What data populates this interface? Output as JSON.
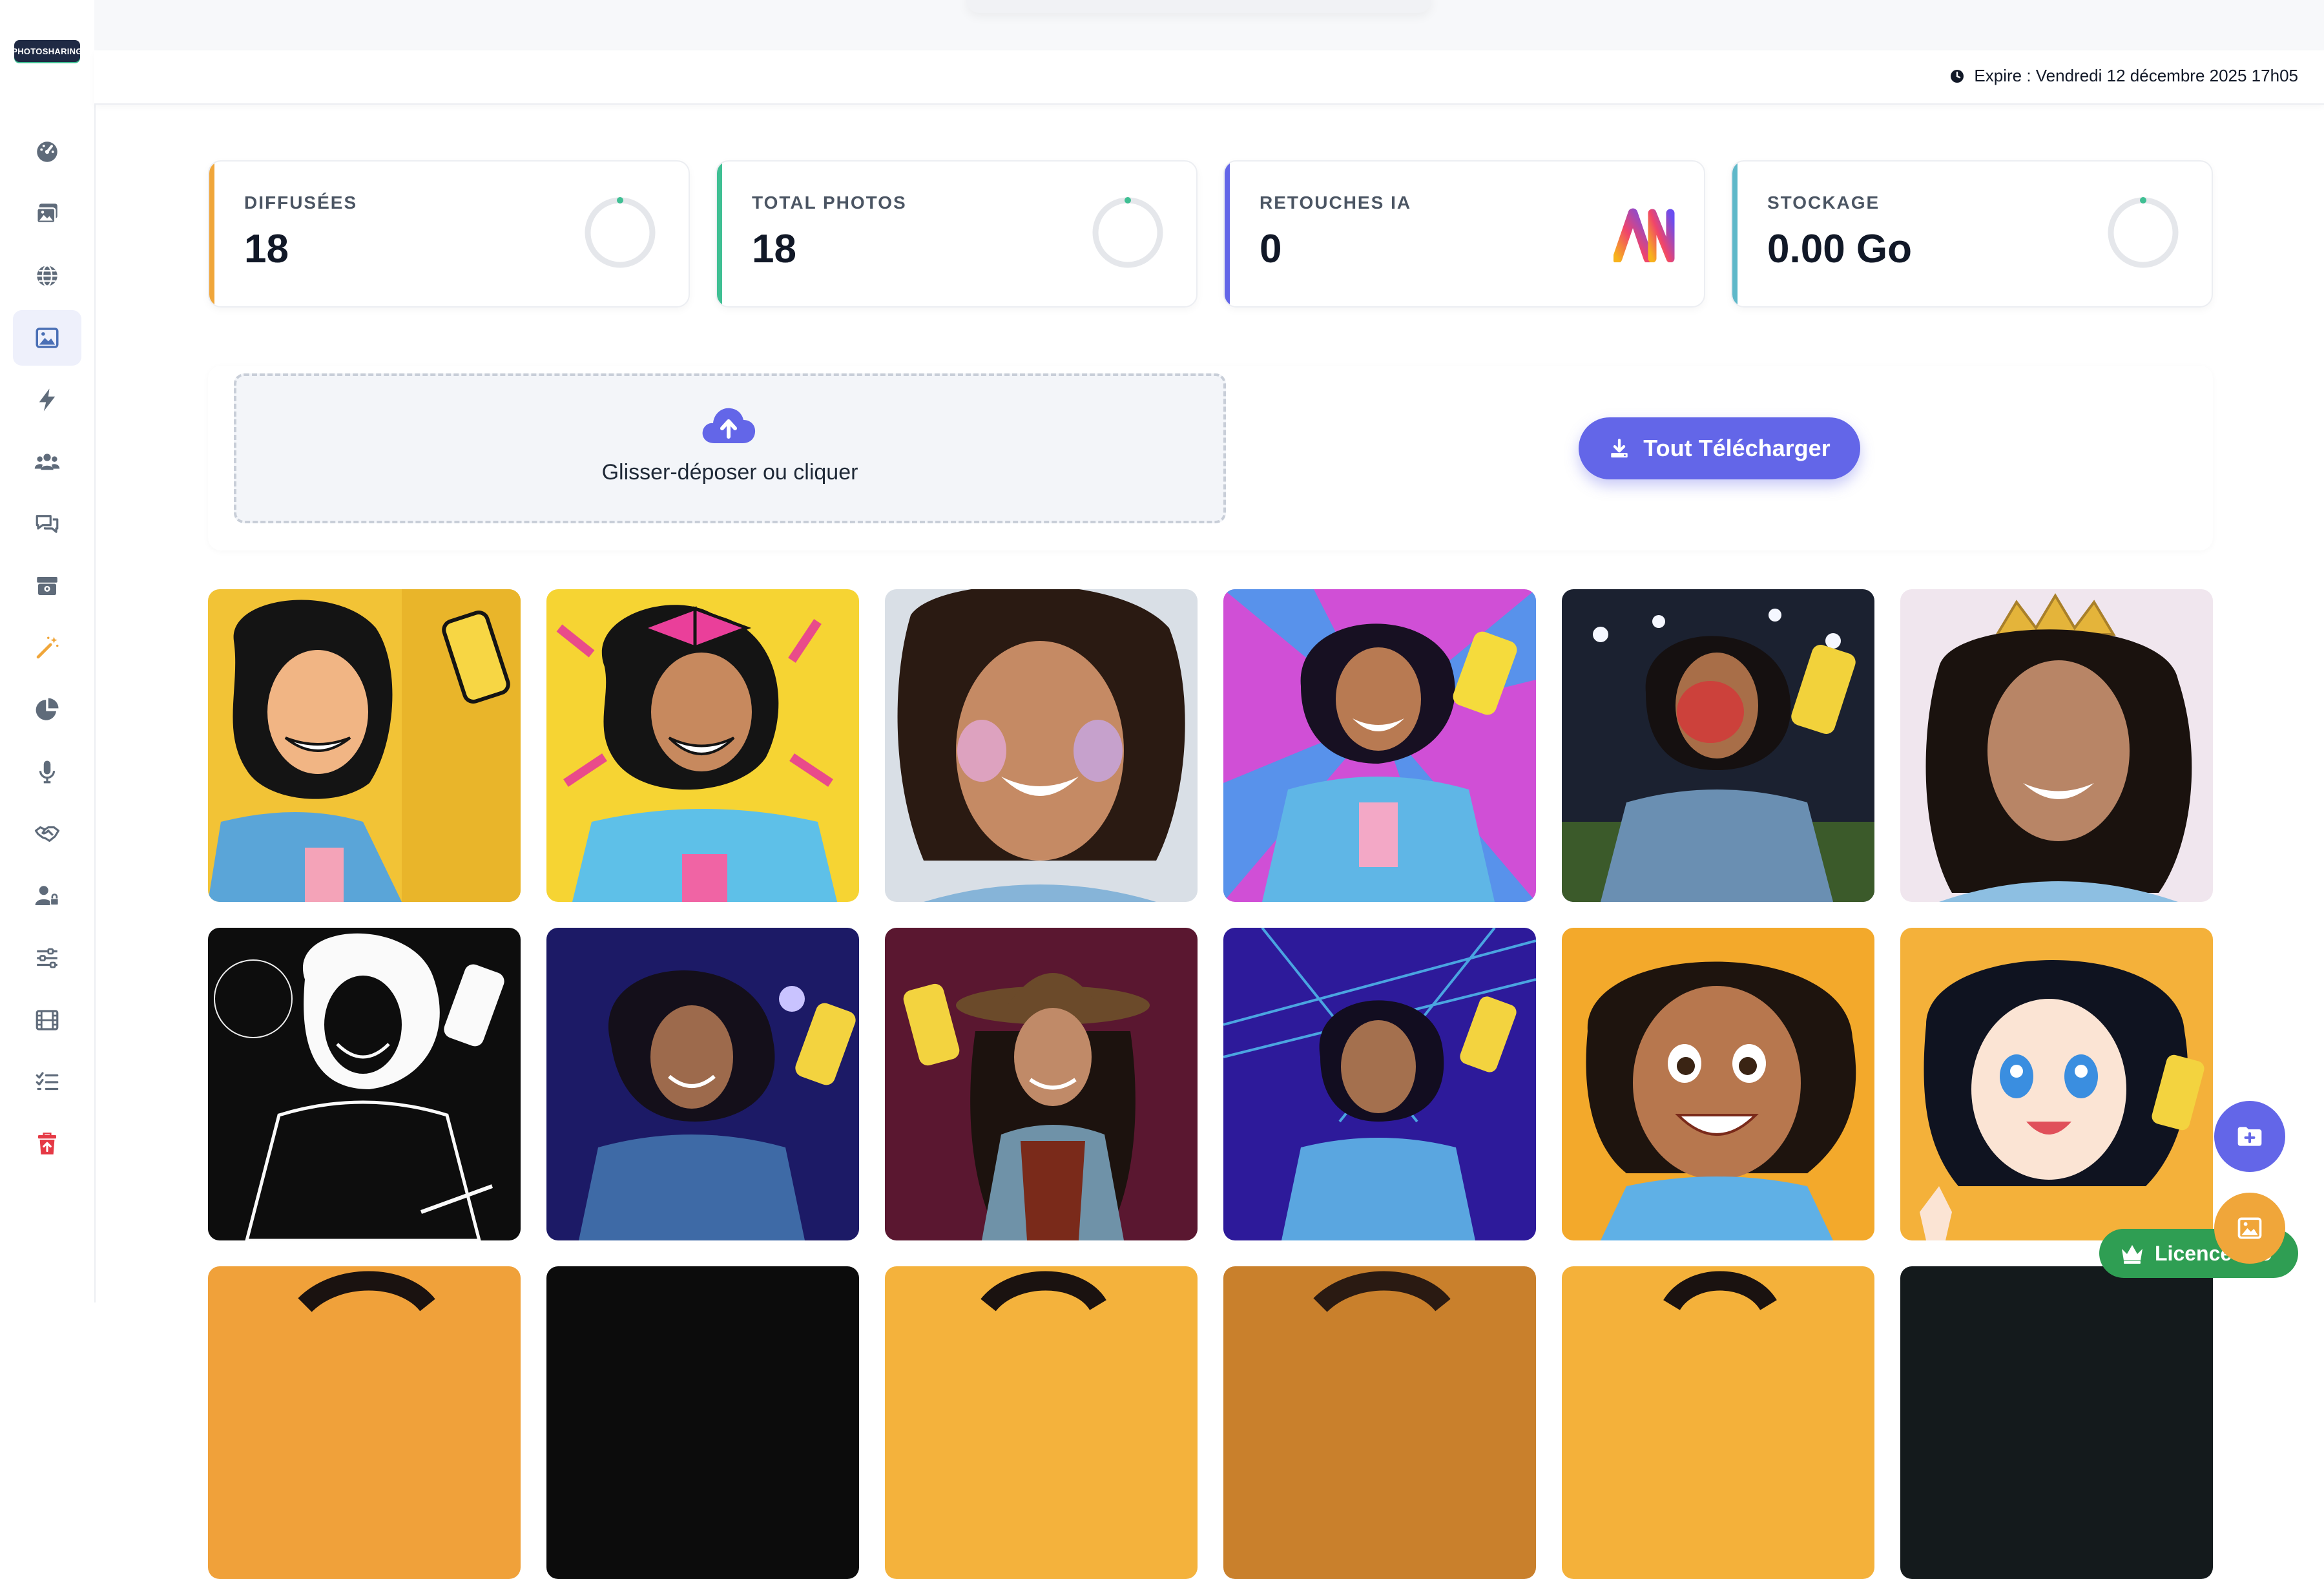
{
  "app": {
    "logo_text": "PHOTOSHARING"
  },
  "header": {
    "expire_text": "Expire : Vendredi 12 décembre 2025 17h05"
  },
  "sidebar": {
    "items": [
      {
        "icon": "dashboard-icon",
        "active": false
      },
      {
        "icon": "photos-icon",
        "active": false
      },
      {
        "icon": "globe-icon",
        "active": false
      },
      {
        "icon": "image-icon",
        "active": true
      },
      {
        "icon": "bolt-icon",
        "active": false
      },
      {
        "icon": "users-icon",
        "active": false
      },
      {
        "icon": "chat-icon",
        "active": false
      },
      {
        "icon": "archive-icon",
        "active": false
      },
      {
        "icon": "magic-wand-icon",
        "active": false
      },
      {
        "icon": "pie-chart-icon",
        "active": false
      },
      {
        "icon": "microphone-icon",
        "active": false
      },
      {
        "icon": "handshake-icon",
        "active": false
      },
      {
        "icon": "user-lock-icon",
        "active": false
      },
      {
        "icon": "sliders-icon",
        "active": false
      },
      {
        "icon": "film-icon",
        "active": false
      },
      {
        "icon": "checklist-icon",
        "active": false
      },
      {
        "icon": "trash-icon",
        "active": false
      }
    ]
  },
  "stats": [
    {
      "label": "DIFFUSÉES",
      "value": "18",
      "color": "#f0a63a",
      "indicator": "ring"
    },
    {
      "label": "TOTAL PHOTOS",
      "value": "18",
      "color": "#3fbf93",
      "indicator": "ring"
    },
    {
      "label": "RETOUCHES IA",
      "value": "0",
      "color": "#6366e8",
      "indicator": "ai-logo"
    },
    {
      "label": "STOCKAGE",
      "value": "0.00 Go",
      "color": "#5fb8c9",
      "indicator": "ring"
    }
  ],
  "upload": {
    "dropzone_text": "Glisser-déposer ou cliquer"
  },
  "actions": {
    "download_all_label": "Tout Télécharger"
  },
  "licence": {
    "label": "Licence Pro"
  },
  "gallery": {
    "photos": [
      {
        "style": "pop-art-comic"
      },
      {
        "style": "pop-art-bow"
      },
      {
        "style": "glitter-makeup"
      },
      {
        "style": "neon-selfie"
      },
      {
        "style": "stadium-face-paint"
      },
      {
        "style": "crown-portrait"
      },
      {
        "style": "black-white-sketch"
      },
      {
        "style": "purple-concert"
      },
      {
        "style": "cowgirl"
      },
      {
        "style": "laser-party"
      },
      {
        "style": "3d-cartoon"
      },
      {
        "style": "anime"
      },
      {
        "style": "partial"
      },
      {
        "style": "partial"
      },
      {
        "style": "partial"
      },
      {
        "style": "partial"
      },
      {
        "style": "partial"
      },
      {
        "style": "partial"
      }
    ]
  },
  "colors": {
    "accent": "#6366e8",
    "fab_primary": "#6366e8",
    "fab_secondary": "#f0a63a",
    "licence": "#2f9e53",
    "danger": "#e53945"
  }
}
